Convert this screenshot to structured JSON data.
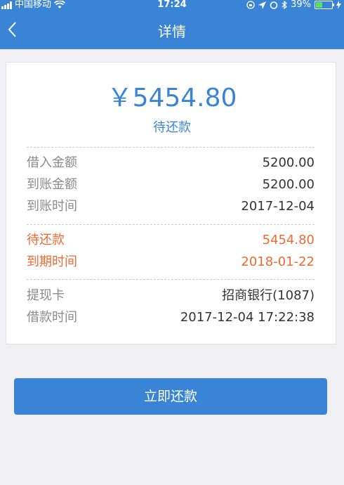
{
  "status_bar": {
    "carrier": "中国移动",
    "time": "17:24",
    "battery": "39%",
    "battery_level": 0.39,
    "icons": [
      "signal-icon",
      "wifi-icon",
      "lock-rotation-icon",
      "location-icon",
      "alarm-icon",
      "bluetooth-icon",
      "battery-icon",
      "charging-icon"
    ]
  },
  "header": {
    "back_icon": "chevron-left-icon",
    "title": "详情"
  },
  "summary": {
    "amount": "￥5454.80",
    "status": "待还款"
  },
  "loan_info": [
    {
      "label": "借入金额",
      "value": "5200.00"
    },
    {
      "label": "到账金额",
      "value": "5200.00"
    },
    {
      "label": "到账时间",
      "value": "2017-12-04"
    }
  ],
  "repayment_info": [
    {
      "label": "待还款",
      "value": "5454.80"
    },
    {
      "label": "到期时间",
      "value": "2018-01-22"
    }
  ],
  "card_info": [
    {
      "label": "提现卡",
      "value": "招商银行(1087)"
    },
    {
      "label": "借款时间",
      "value": "2017-12-04 17:22:38"
    }
  ],
  "actions": {
    "repay_label": "立即还款"
  },
  "colors": {
    "primary": "#3a84d6",
    "accent": "#ee6a32",
    "background": "#efeff4"
  }
}
